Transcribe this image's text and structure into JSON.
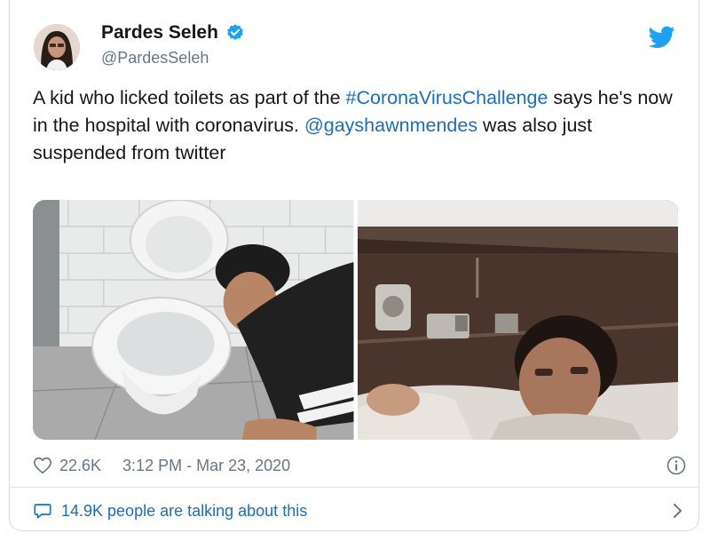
{
  "author": {
    "display_name": "Pardes Seleh",
    "handle": "@PardesSeleh",
    "avatar_icon": "avatar-photo",
    "verified_icon": "verified-badge-icon"
  },
  "tweet": {
    "text_part1": "A kid who licked toilets as part of the ",
    "hashtag": "#CoronaVirusChallenge",
    "text_part2": " says he's now in the hospital with coronavirus. ",
    "mention": "@gayshawnmendes",
    "text_part3": " was also just suspended from twitter"
  },
  "media": {
    "photos": [
      "toilet-photo",
      "hospital-photo"
    ]
  },
  "meta": {
    "likes": "22.6K",
    "timestamp": "3:12 PM - Mar 23, 2020"
  },
  "footer": {
    "talking_text": "14.9K people are talking about this"
  },
  "colors": {
    "link": "#1b6fb8",
    "twitter_blue": "#1da1f2",
    "muted": "#657786"
  }
}
